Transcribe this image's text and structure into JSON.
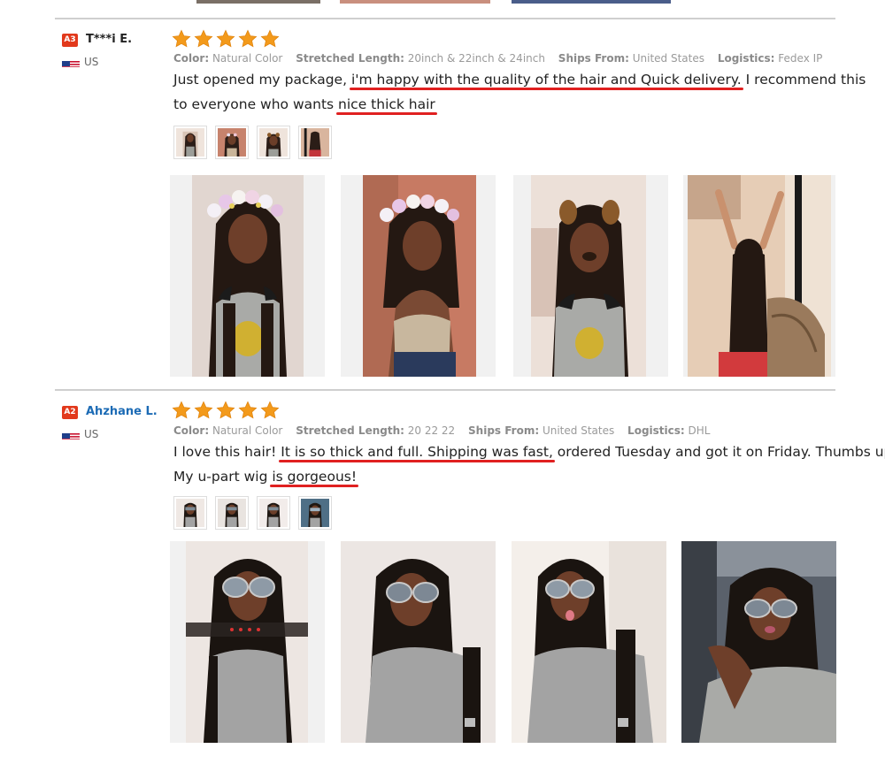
{
  "reviews": [
    {
      "level": "A3",
      "name": "T***i E.",
      "country": "US",
      "rating": 5,
      "meta": {
        "color_label": "Color:",
        "color_value": "Natural Color",
        "length_label": "Stretched Length:",
        "length_value": "20inch & 22inch & 24inch",
        "ships_label": "Ships From:",
        "ships_value": "United States",
        "logistics_label": "Logistics:",
        "logistics_value": "Fedex IP"
      },
      "text": {
        "p1": "Just opened my package, ",
        "h1": "i'm happy with the quality of the hair and Quick delivery.",
        "p2": " I recommend this",
        "p3": "to everyone who wants ",
        "h2": "nice thick hair"
      }
    },
    {
      "level": "A2",
      "name": "Ahzhane L.",
      "country": "US",
      "rating": 5,
      "meta": {
        "color_label": "Color:",
        "color_value": "Natural Color",
        "length_label": "Stretched Length:",
        "length_value": "20 22 22",
        "ships_label": "Ships From:",
        "ships_value": "United States",
        "logistics_label": "Logistics:",
        "logistics_value": "DHL"
      },
      "text": {
        "p1": "I love this hair! ",
        "h1": "It is so thick and full. Shipping was fast,",
        "p2": " ordered Tuesday and got it on Friday. Thumbs up!",
        "p3": "My u-part wig ",
        "h2": "is gorgeous!"
      }
    }
  ],
  "icons": {
    "star": "star-icon",
    "flag": "us-flag-icon"
  },
  "colors": {
    "star": "#f39a1b",
    "highlight_underline": "#e02020",
    "badge": "#e2391c",
    "link_name": "#1c6bb5"
  }
}
